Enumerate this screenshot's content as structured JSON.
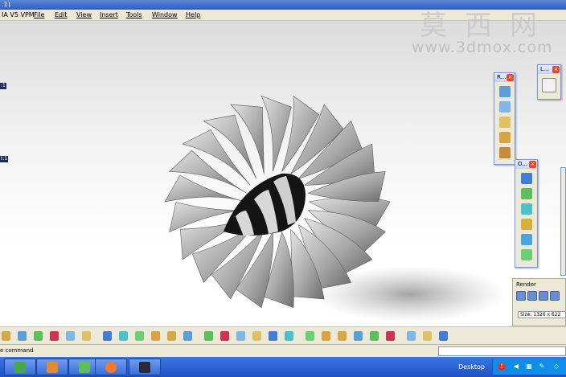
{
  "window": {
    "title": ".1]",
    "app_title": "IA V5 VPM"
  },
  "menu": [
    "File",
    "Edit",
    "View",
    "Insert",
    "Tools",
    "Window",
    "Help"
  ],
  "tree": {
    "node1": ":1",
    "node2": "t:1"
  },
  "watermark": {
    "chinese": "莫西网",
    "url": "www.3dmox.com"
  },
  "toolbar_r": {
    "title": "R..."
  },
  "toolbar_l": {
    "title": "L..."
  },
  "toolbar_o": {
    "title": "O..."
  },
  "render_panel": {
    "title": "Render",
    "size": "Size: 1326 x 622"
  },
  "status": {
    "command_label": "e command",
    "command_value": ""
  },
  "taskbar": {
    "desktop": "Desktop"
  },
  "colors": {
    "blade": "#b9b9b9",
    "nose": "#1a1a1a",
    "titlebar": "#2f5fbf",
    "taskbar": "#1f51c4"
  }
}
